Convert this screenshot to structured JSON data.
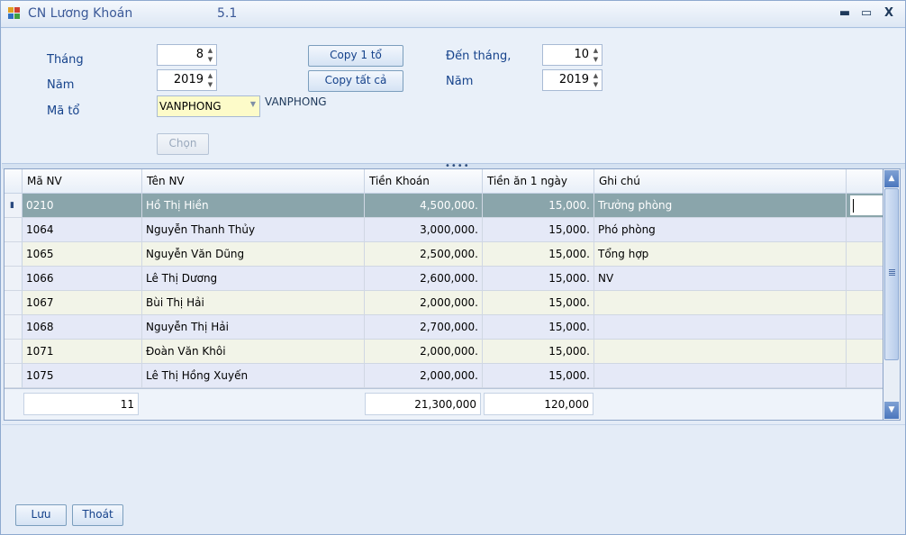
{
  "window": {
    "title": "CN Lương Khoán",
    "version": "5.1",
    "minimize_label": "▬",
    "restore_label": "▭",
    "close_label": "X"
  },
  "filters": {
    "thang_label": "Tháng",
    "thang_value": "8",
    "nam_label": "Năm",
    "nam_value": "2019",
    "mato_label": "Mã tổ",
    "mato_value": "VANPHONG",
    "mato_display": "VANPHONG",
    "den_thang_label": "Đến  tháng,",
    "den_thang_value": "10",
    "nam2_label": "Năm",
    "nam2_value": "2019",
    "copy_one_label": "Copy 1 tổ",
    "copy_all_label": "Copy tất cả",
    "chon_label": "Chọn"
  },
  "grid": {
    "columns": [
      "Mã NV",
      "Tên NV",
      "Tiền Khoán",
      "Tiền ăn 1 ngày",
      "Ghi chú"
    ],
    "rows": [
      {
        "ma": "0210",
        "ten": "Hồ Thị Hiền",
        "tien_khoan": "4,500,000.",
        "tien_an": "15,000.",
        "ghi_chu": "Trưởng phòng"
      },
      {
        "ma": "1064",
        "ten": "Nguyễn Thanh Thủy",
        "tien_khoan": "3,000,000.",
        "tien_an": "15,000.",
        "ghi_chu": "Phó phòng"
      },
      {
        "ma": "1065",
        "ten": "Nguyễn Văn Dũng",
        "tien_khoan": "2,500,000.",
        "tien_an": "15,000.",
        "ghi_chu": "Tổng hợp"
      },
      {
        "ma": "1066",
        "ten": "Lê Thị Dương",
        "tien_khoan": "2,600,000.",
        "tien_an": "15,000.",
        "ghi_chu": "NV"
      },
      {
        "ma": "1067",
        "ten": "Bùi Thị Hải",
        "tien_khoan": "2,000,000.",
        "tien_an": "15,000.",
        "ghi_chu": ""
      },
      {
        "ma": "1068",
        "ten": "Nguyễn Thị Hải",
        "tien_khoan": "2,700,000.",
        "tien_an": "15,000.",
        "ghi_chu": ""
      },
      {
        "ma": "1071",
        "ten": "Đoàn Văn Khôi",
        "tien_khoan": "2,000,000.",
        "tien_an": "15,000.",
        "ghi_chu": ""
      },
      {
        "ma": "1075",
        "ten": "Lê Thị Hồng Xuyến",
        "tien_khoan": "2,000,000.",
        "tien_an": "15,000.",
        "ghi_chu": ""
      }
    ],
    "footer": {
      "count": "11",
      "tien_khoan_total": "21,300,000",
      "tien_an_total": "120,000"
    }
  },
  "actions": {
    "save_label": "Lưu",
    "exit_label": "Thoát"
  }
}
